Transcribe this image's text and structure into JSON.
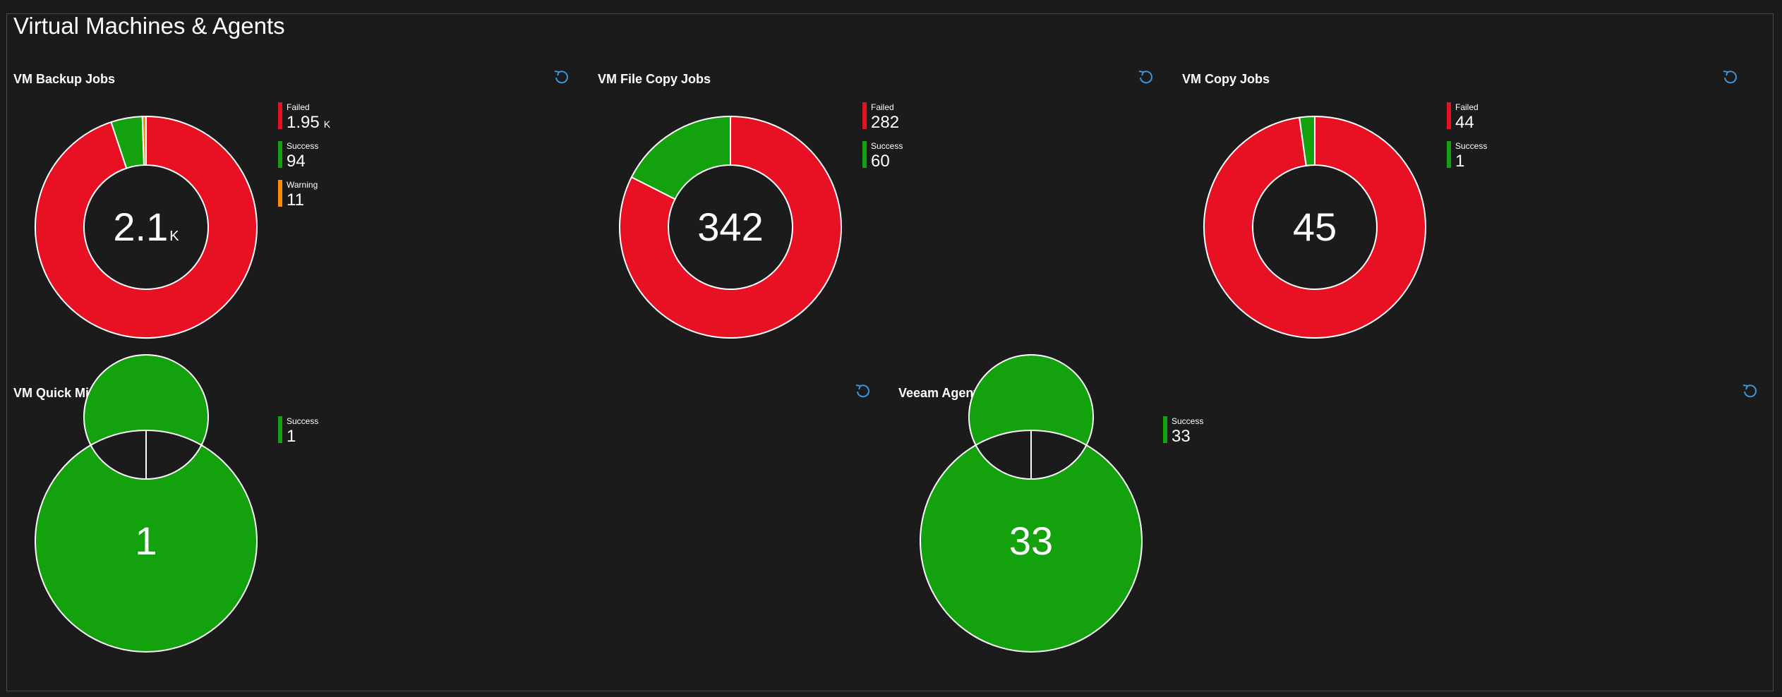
{
  "page_title": "Virtual Machines & Agents",
  "colors": {
    "failed": "#e81123",
    "success": "#13a10e",
    "warning": "#ff8c00",
    "background": "#1b1b1b",
    "refresh_icon": "#3a96dd"
  },
  "icons": {
    "refresh": "refresh-icon"
  },
  "panels": [
    {
      "title": "VM Backup Jobs",
      "total": "2.1",
      "total_unit": "K",
      "legend": [
        {
          "label": "Failed",
          "value": "1.95",
          "unit": "K",
          "color": "#e81123"
        },
        {
          "label": "Success",
          "value": "94",
          "unit": "",
          "color": "#13a10e"
        },
        {
          "label": "Warning",
          "value": "11",
          "unit": "",
          "color": "#ff8c00"
        }
      ]
    },
    {
      "title": "VM File Copy Jobs",
      "total": "342",
      "total_unit": "",
      "legend": [
        {
          "label": "Failed",
          "value": "282",
          "unit": "",
          "color": "#e81123"
        },
        {
          "label": "Success",
          "value": "60",
          "unit": "",
          "color": "#13a10e"
        }
      ]
    },
    {
      "title": "VM Copy Jobs",
      "total": "45",
      "total_unit": "",
      "legend": [
        {
          "label": "Failed",
          "value": "44",
          "unit": "",
          "color": "#e81123"
        },
        {
          "label": "Success",
          "value": "1",
          "unit": "",
          "color": "#13a10e"
        }
      ]
    },
    {
      "title": "VM Quick Migration Jobs",
      "total": "1",
      "total_unit": "",
      "legend": [
        {
          "label": "Success",
          "value": "1",
          "unit": "",
          "color": "#13a10e"
        }
      ]
    },
    {
      "title": "Veeam Agent Jobs",
      "total": "33",
      "total_unit": "",
      "legend": [
        {
          "label": "Success",
          "value": "33",
          "unit": "",
          "color": "#13a10e"
        }
      ]
    }
  ],
  "chart_data": [
    {
      "type": "pie",
      "title": "VM Backup Jobs",
      "categories": [
        "Failed",
        "Success",
        "Warning"
      ],
      "values": [
        1950,
        94,
        11
      ]
    },
    {
      "type": "pie",
      "title": "VM File Copy Jobs",
      "categories": [
        "Failed",
        "Success"
      ],
      "values": [
        282,
        60
      ]
    },
    {
      "type": "pie",
      "title": "VM Copy Jobs",
      "categories": [
        "Failed",
        "Success"
      ],
      "values": [
        44,
        1
      ]
    },
    {
      "type": "pie",
      "title": "VM Quick Migration Jobs",
      "categories": [
        "Success"
      ],
      "values": [
        1
      ]
    },
    {
      "type": "pie",
      "title": "Veeam Agent Jobs",
      "categories": [
        "Success"
      ],
      "values": [
        33
      ]
    }
  ]
}
